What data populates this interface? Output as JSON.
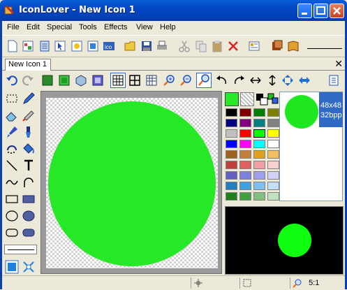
{
  "window": {
    "title": "IconLover - New Icon 1"
  },
  "menu": [
    "File",
    "Edit",
    "Special",
    "Tools",
    "Effects",
    "View",
    "Help"
  ],
  "tabs": [
    {
      "label": "New Icon 1"
    }
  ],
  "preview": {
    "size_label": "48x48",
    "depth_label": "32bpp"
  },
  "status": {
    "zoom": "5:1"
  },
  "colors": {
    "primary": "#27e827",
    "palette": [
      "#000000",
      "#800000",
      "#008000",
      "#808000",
      "#000080",
      "#800080",
      "#008080",
      "#808080",
      "#c0c0c0",
      "#ff0000",
      "#00ff00",
      "#ffff00",
      "#0000ff",
      "#ff00ff",
      "#00ffff",
      "#ffffff",
      "#a06020",
      "#c08040",
      "#e0a020",
      "#f0c060",
      "#c04040",
      "#e06060",
      "#f0a0a0",
      "#f8d0d0",
      "#6060c0",
      "#8080e0",
      "#a0a0f0",
      "#d0d0f8",
      "#2080c0",
      "#40a0e0",
      "#80c0f0",
      "#c0e0f8",
      "#208020",
      "#40a040",
      "#80c080",
      "#c0e0c0"
    ]
  }
}
